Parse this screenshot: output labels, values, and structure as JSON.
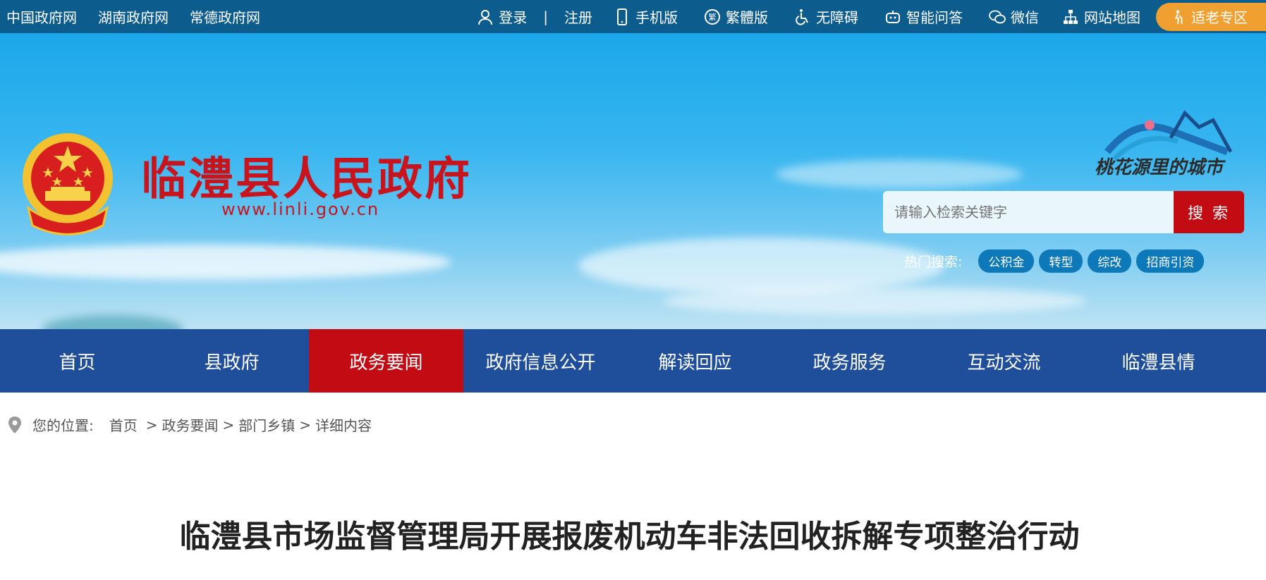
{
  "topbar": {
    "links": [
      "中国政府网",
      "湖南政府网",
      "常德政府网"
    ],
    "login": "登录",
    "separator": "|",
    "register": "注册",
    "mobile": "手机版",
    "traditional": "繁體版",
    "accessible": "无障碍",
    "qa": "智能问答",
    "wechat": "微信",
    "sitemap": "网站地图",
    "elder": "适老专区"
  },
  "banner": {
    "title": "临澧县人民政府",
    "url": "www.linli.gov.cn",
    "slogan": "桃花源里的城市",
    "search_placeholder": "请输入检索关键字",
    "search_button": "搜 索",
    "hot_label": "热门搜索:",
    "hot_tags": [
      "公积金",
      "转型",
      "综改",
      "招商引资"
    ]
  },
  "nav": {
    "items": [
      "首页",
      "县政府",
      "政务要闻",
      "政府信息公开",
      "解读回应",
      "政务服务",
      "互动交流",
      "临澧县情"
    ],
    "active_index": 2
  },
  "breadcrumb": {
    "label": "您的位置:",
    "items": [
      "首页",
      "政务要闻",
      "部门乡镇",
      "详细内容"
    ],
    "sep": ">"
  },
  "article": {
    "title": "临澧县市场监督管理局开展报废机动车非法回收拆解专项整治行动"
  },
  "colors": {
    "topbar": "#0d5c8e",
    "nav": "#1f4e9a",
    "accent": "#c20b12",
    "elder": "#f0a030"
  }
}
